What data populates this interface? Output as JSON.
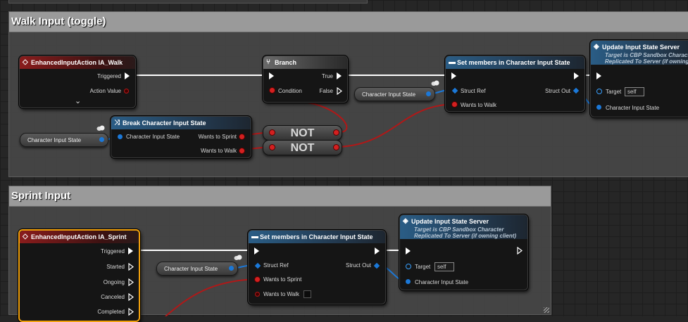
{
  "comments": [
    {
      "title": "Walk Input (toggle)"
    },
    {
      "title": "Sprint Input"
    }
  ],
  "walk": {
    "event": {
      "title": "EnhancedInputAction IA_Walk",
      "pins": [
        "Triggered",
        "Action Value"
      ]
    },
    "branch": {
      "title": "Branch",
      "condition": "Condition",
      "true": "True",
      "false": "False"
    },
    "set_members": {
      "title": "Set members in Character Input State",
      "struct_ref": "Struct Ref",
      "struct_out": "Struct Out",
      "field": "Wants to Walk"
    },
    "update": {
      "title": "Update Input State Server",
      "sub1": "Target is CBP Sandbox Character",
      "sub2": "Replicated To Server (if owning client)",
      "target": "Target",
      "self": "self",
      "param": "Character Input State"
    },
    "break": {
      "title": "Break Character Input State",
      "in": "Character Input State",
      "out1": "Wants to Sprint",
      "out2": "Wants to Walk"
    },
    "reroute1": "Character Input State",
    "reroute2": "Character Input State",
    "not1": "NOT",
    "not2": "NOT"
  },
  "sprint": {
    "event": {
      "title": "EnhancedInputAction IA_Sprint",
      "pins": [
        "Triggered",
        "Started",
        "Ongoing",
        "Canceled",
        "Completed"
      ]
    },
    "set_members": {
      "title": "Set members in Character Input State",
      "struct_ref": "Struct Ref",
      "struct_out": "Struct Out",
      "field1": "Wants to Sprint",
      "field2": "Wants to Walk"
    },
    "update": {
      "title": "Update Input State Server",
      "sub1": "Target is CBP Sandbox Character",
      "sub2": "Replicated To Server (if owning client)",
      "target": "Target",
      "self": "self",
      "param": "Character Input State"
    },
    "reroute": "Character Input State"
  },
  "colors": {
    "exec": "#ffffff",
    "bool": "#d32020",
    "struct": "#1b78d8",
    "selected": "#f1a10d"
  }
}
